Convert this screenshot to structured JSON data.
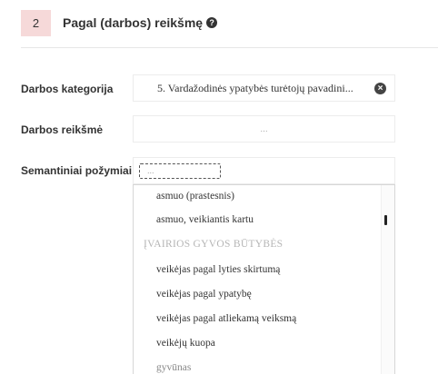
{
  "section": {
    "number": "2",
    "title": "Pagal (darbos) reikšmę"
  },
  "fields": {
    "category": {
      "label": "Darbos kategorija",
      "value": "5. Vardažodinės ypatybės turėtojų pavadini..."
    },
    "meaning": {
      "label": "Darbos reikšmė",
      "value": "..."
    },
    "semantic": {
      "label": "Semantiniai požymiai",
      "placeholder": "..."
    }
  },
  "dropdown": {
    "items": [
      {
        "text": "asmuo (prastesnis)",
        "type": "option"
      },
      {
        "text": "asmuo, veikiantis kartu",
        "type": "option"
      },
      {
        "text": "ĮVAIRIOS GYVOS BŪTYBĖS",
        "type": "group"
      },
      {
        "text": "veikėjas pagal lyties skirtumą",
        "type": "option"
      },
      {
        "text": "veikėjas pagal ypatybę",
        "type": "option"
      },
      {
        "text": "veikėjas pagal atliekamą veiksmą",
        "type": "option"
      },
      {
        "text": "veikėjų kuopa",
        "type": "option"
      },
      {
        "text": "gyvūnas",
        "type": "option"
      }
    ]
  },
  "icons": {
    "help": "question-circle-icon",
    "clear": "clear-x-icon"
  }
}
